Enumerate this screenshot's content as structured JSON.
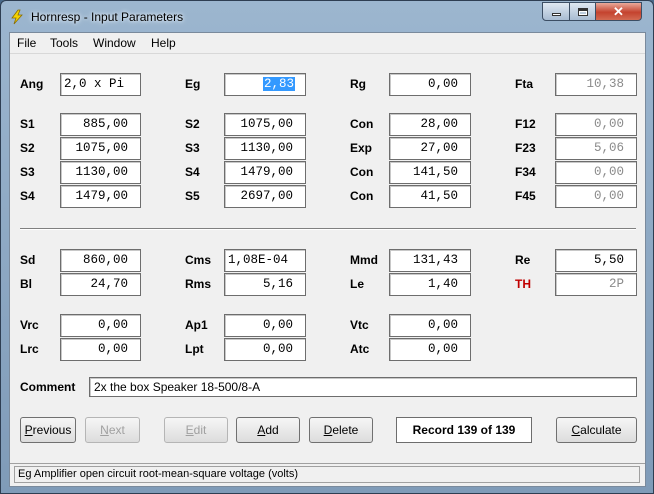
{
  "window": {
    "title": "Hornresp - Input Parameters"
  },
  "menu": [
    "File",
    "Tools",
    "Window",
    "Help"
  ],
  "params": {
    "ang": {
      "label": "Ang",
      "value": "2,0 x Pi"
    },
    "eg": {
      "label": "Eg",
      "value": "2,83"
    },
    "rg": {
      "label": "Rg",
      "value": "0,00"
    },
    "fta": {
      "label": "Fta",
      "value": "10,38"
    },
    "s1": {
      "label": "S1",
      "value": "885,00"
    },
    "s2a": {
      "label": "S2",
      "value": "1075,00"
    },
    "s3a": {
      "label": "S3",
      "value": "1130,00"
    },
    "s4a": {
      "label": "S4",
      "value": "1479,00"
    },
    "s2b": {
      "label": "S2",
      "value": "1075,00"
    },
    "s3b": {
      "label": "S3",
      "value": "1130,00"
    },
    "s4b": {
      "label": "S4",
      "value": "1479,00"
    },
    "s5": {
      "label": "S5",
      "value": "2697,00"
    },
    "con1": {
      "label": "Con",
      "value": "28,00"
    },
    "exp": {
      "label": "Exp",
      "value": "27,00"
    },
    "con3": {
      "label": "Con",
      "value": "141,50"
    },
    "con4": {
      "label": "Con",
      "value": "41,50"
    },
    "f12": {
      "label": "F12",
      "value": "0,00"
    },
    "f23": {
      "label": "F23",
      "value": "5,06"
    },
    "f34": {
      "label": "F34",
      "value": "0,00"
    },
    "f45": {
      "label": "F45",
      "value": "0,00"
    },
    "sd": {
      "label": "Sd",
      "value": "860,00"
    },
    "bl": {
      "label": "Bl",
      "value": "24,70"
    },
    "cms": {
      "label": "Cms",
      "value": "1,08E-04"
    },
    "rms": {
      "label": "Rms",
      "value": "5,16"
    },
    "mmd": {
      "label": "Mmd",
      "value": "131,43"
    },
    "le": {
      "label": "Le",
      "value": "1,40"
    },
    "re": {
      "label": "Re",
      "value": "5,50"
    },
    "th": {
      "label": "TH",
      "value": "2P"
    },
    "vrc": {
      "label": "Vrc",
      "value": "0,00"
    },
    "lrc": {
      "label": "Lrc",
      "value": "0,00"
    },
    "ap1": {
      "label": "Ap1",
      "value": "0,00"
    },
    "lpt": {
      "label": "Lpt",
      "value": "0,00"
    },
    "vtc": {
      "label": "Vtc",
      "value": "0,00"
    },
    "atc": {
      "label": "Atc",
      "value": "0,00"
    }
  },
  "comment": {
    "label": "Comment",
    "value": "2x the box Speaker 18-500/8-A"
  },
  "buttons": {
    "previous": {
      "accel": "P",
      "rest": "revious"
    },
    "next": {
      "accel": "N",
      "rest": "ext"
    },
    "edit": {
      "accel": "E",
      "rest": "dit"
    },
    "add": {
      "accel": "A",
      "rest": "dd"
    },
    "delete": {
      "accel": "D",
      "rest": "elete"
    },
    "calculate": {
      "accel": "C",
      "rest": "alculate"
    }
  },
  "record": "Record 139 of 139",
  "status": "Eg   Amplifier open circuit root-mean-square voltage  (volts)",
  "colors": {
    "selection": "#3399ff",
    "th_label": "#c00000",
    "close_button": "#c4432e"
  }
}
